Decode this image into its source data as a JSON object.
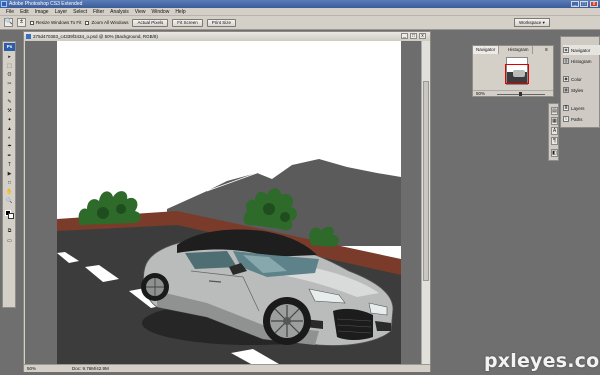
{
  "app": {
    "title": "Adobe Photoshop CS3 Extended",
    "window_buttons": [
      "_",
      "□",
      "x"
    ]
  },
  "menu": [
    "File",
    "Edit",
    "Image",
    "Layer",
    "Select",
    "Filter",
    "Analysis",
    "View",
    "Window",
    "Help"
  ],
  "options_bar": {
    "zoom_tool_glyph": "🔍",
    "zoom_mode_glyph": "±",
    "resize_windows_label": "Resize Windows To Fit",
    "zoom_all_windows_label": "Zoom All Windows",
    "actual_pixels_label": "Actual Pixels",
    "fit_screen_label": "Fit Screen",
    "print_size_label": "Print Size",
    "workspace_label": "Workspace ▾"
  },
  "tools": {
    "badge": "Ps",
    "glyphs": [
      "▸",
      "⬚",
      "ʘ",
      "✂",
      "⌖",
      "✎",
      "⚒",
      "✦",
      "▲",
      "◐",
      "☂",
      "✒",
      "T",
      "▶",
      "□",
      "✋",
      "🔍",
      "■",
      "⧉",
      "▭"
    ]
  },
  "document": {
    "title": "375d470383_c4339f3434_o.psd @ 50% (Background, RGB/8)",
    "zoom": "50%",
    "doc_size": "Doc: 9.76M/42.9M",
    "window_buttons": [
      "_",
      "□",
      "x"
    ]
  },
  "navigator": {
    "tabs": [
      "Navigator",
      "Histogram"
    ],
    "zoom": "50%",
    "menu_glyph": "≡"
  },
  "dock": {
    "items": [
      {
        "label": "Navigator",
        "icon": "navigator-icon",
        "glyph": "◈"
      },
      {
        "label": "Histogram",
        "icon": "histogram-icon",
        "glyph": "▥"
      },
      {
        "label": "Color",
        "icon": "color-icon",
        "glyph": "◉"
      },
      {
        "label": "Styles",
        "icon": "styles-icon",
        "glyph": "▦"
      },
      {
        "label": "Layers",
        "icon": "layers-icon",
        "glyph": "≣"
      },
      {
        "label": "Paths",
        "icon": "paths-icon",
        "glyph": "⌇"
      }
    ]
  },
  "mini_dock": {
    "glyphs": [
      "▤",
      "▦",
      "A",
      "¶",
      "◧"
    ]
  },
  "watermark": "pxleyes.com",
  "colors": {
    "titlebar": "#3b5c99",
    "chrome": "#d4d0c8",
    "canvas_bg": "#6d6d6d",
    "road": "#3f3f3f",
    "car_body": "#b9bcbb",
    "grass": "#2e6a2a",
    "mountain": "#595959",
    "wall": "#7a3b2a"
  }
}
